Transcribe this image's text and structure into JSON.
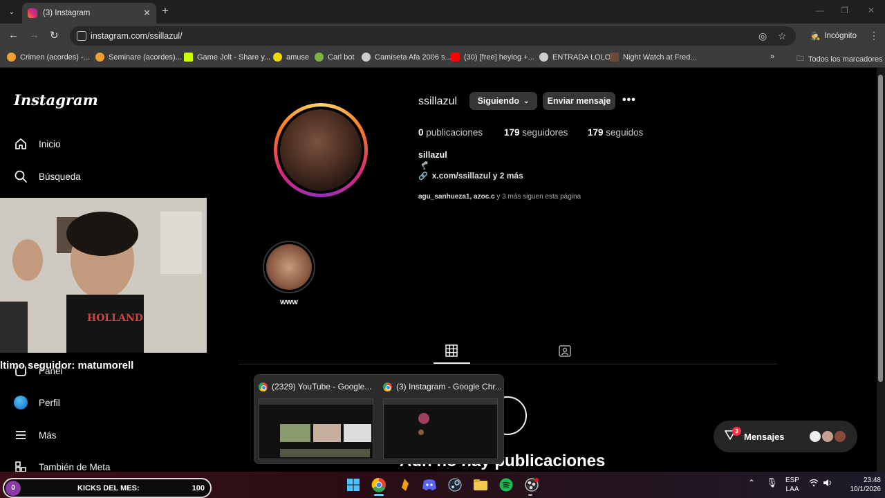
{
  "browser": {
    "tab_title": "(3) Instagram",
    "url": "instagram.com/ssillazul/",
    "incognito_label": "Incógnito",
    "bookmarks": [
      {
        "label": "Crimen (acordes) -...",
        "icon_color": "#f0a030"
      },
      {
        "label": "Seminare (acordes)...",
        "icon_color": "#f0a030"
      },
      {
        "label": "Game Jolt - Share y...",
        "icon_color": "#ccff00"
      },
      {
        "label": "amuse",
        "icon_color": "#f2d600"
      },
      {
        "label": "Carl bot",
        "icon_color": "#7bb342"
      },
      {
        "label": "Camiseta Afa 2006 s...",
        "icon_color": "#cfcfcf"
      },
      {
        "label": "(30) [free] heylog +...",
        "icon_color": "#ff0000"
      },
      {
        "label": "ENTRADA LOLO",
        "icon_color": "#cfcfcf"
      },
      {
        "label": "Night Watch at Fred...",
        "icon_color": "#6b4a3a"
      }
    ],
    "all_bookmarks_label": "Todos los marcadores"
  },
  "sidebar": {
    "logo": "Instagram",
    "items": [
      {
        "label": "Inicio",
        "icon": "home-icon"
      },
      {
        "label": "Búsqueda",
        "icon": "search-icon"
      },
      {
        "label": "Panel",
        "icon": "panel-icon"
      },
      {
        "label": "Perfil",
        "icon": "profile-icon"
      },
      {
        "label": "Más",
        "icon": "menu-icon"
      },
      {
        "label": "También de Meta",
        "icon": "meta-icon"
      }
    ]
  },
  "stream_overlay": {
    "last_follower": "ltimo seguidor: matumorell",
    "kicks_count": "0",
    "kicks_label": "KICKS DEL MES:",
    "kicks_goal": "100"
  },
  "profile": {
    "username": "ssillazul",
    "following_button": "Siguiendo",
    "message_button": "Enviar mensaje",
    "more": "•••",
    "posts_count": "0",
    "posts_label": "publicaciones",
    "followers_count": "179",
    "followers_label": "seguidores",
    "following_count": "179",
    "following_label": "seguidos",
    "full_name": "sillazul",
    "bio_emoji": "🦿",
    "link": "x.com/ssillazul y 2 más",
    "followed_by_names": "agu_sanhueza1, azoc.c",
    "followed_by_rest": " y 3 más siguen esta página",
    "highlight_label": "www",
    "no_posts": "Aún no hay publicaciones"
  },
  "taskbar_preview": [
    {
      "title": "(2329) YouTube - Google..."
    },
    {
      "title": "(3) Instagram - Google Chr..."
    }
  ],
  "messages": {
    "label": "Mensajes",
    "badge": "3"
  },
  "system_tray": {
    "lang": "ESP",
    "layout": "LAA",
    "time": "23:48",
    "date": "10/1/2026"
  }
}
